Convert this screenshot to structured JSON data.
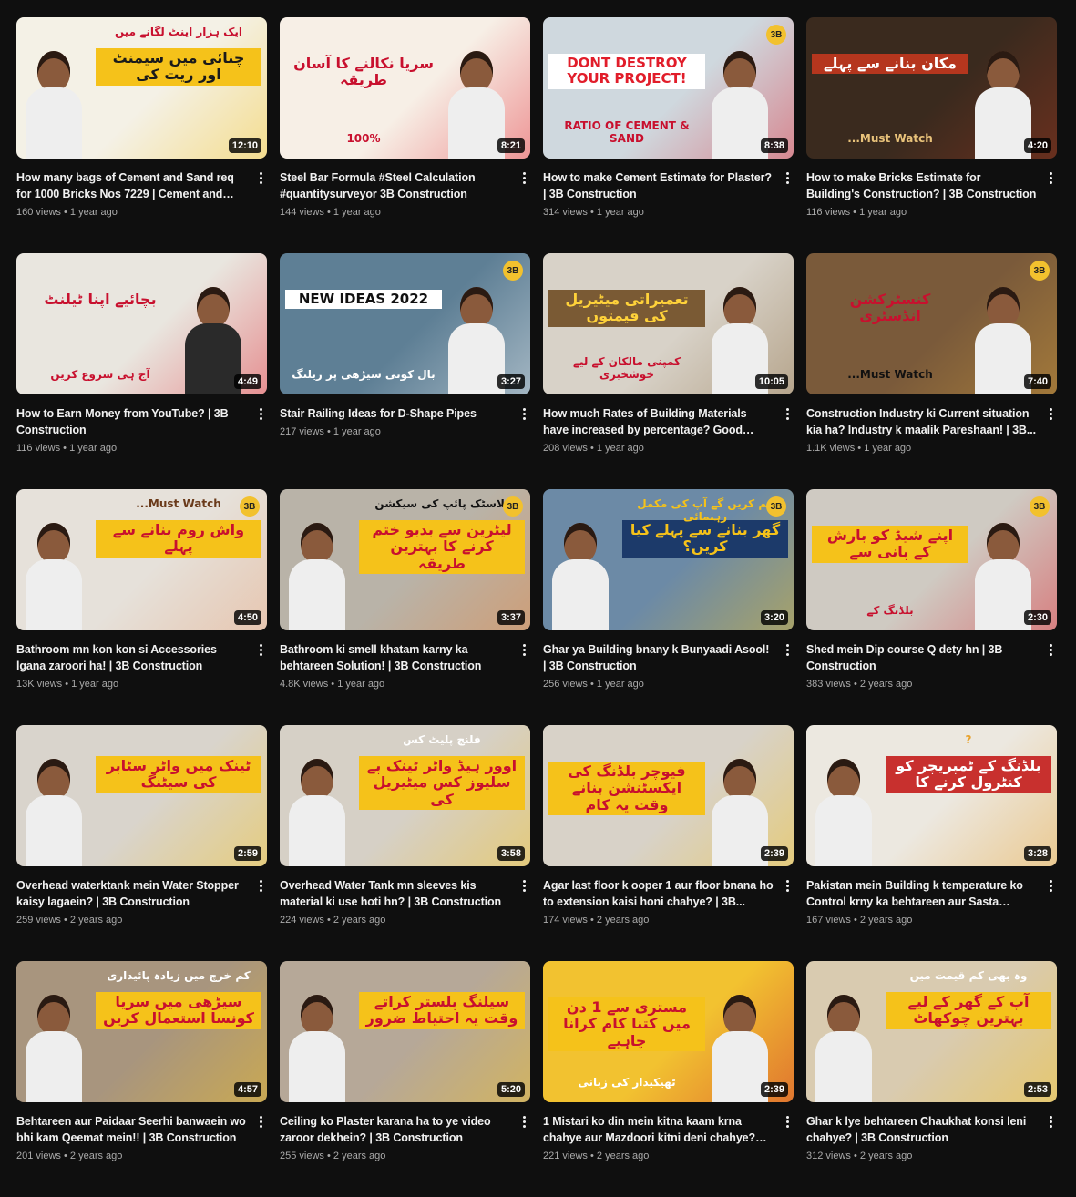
{
  "videos": [
    {
      "title": "How many bags of Cement and Sand req for 1000 Bricks Nos 7229 | Cement and Sand i...",
      "views": "160 views",
      "age": "1 year ago",
      "duration": "12:10",
      "thumb": {
        "bg": "#f4f1e6",
        "accent": "#f5c21a",
        "overlay_color": "#1a1a1a",
        "overlay_bg": "#f5c21a",
        "overlay": "چنائی میں سیمنٹ اور ریت کی",
        "overlay2": "ایک ہزار اینٹ لگانے میں",
        "overlay2_color": "#c8102e"
      }
    },
    {
      "title": "Steel Bar Formula #Steel Calculation #quantitysurveyor 3B Construction",
      "views": "144 views",
      "age": "1 year ago",
      "duration": "8:21",
      "thumb": {
        "bg": "#f7efe6",
        "accent": "#e11d2a",
        "overlay_color": "#c8102e",
        "overlay_bg": "transparent",
        "overlay": "سریا نکالنے کا آسان طریقہ",
        "overlay2": "100%",
        "overlay2_color": "#c8102e"
      }
    },
    {
      "title": "How to make Cement Estimate for Plaster? | 3B Construction",
      "views": "314 views",
      "age": "1 year ago",
      "duration": "8:38",
      "thumb": {
        "bg": "#cfd8de",
        "accent": "#e11d2a",
        "overlay_color": "#e11d2a",
        "overlay_bg": "#ffffff",
        "overlay": "DONT DESTROY YOUR PROJECT!",
        "overlay2": "RATIO OF CEMENT & SAND",
        "overlay2_color": "#c8102e",
        "en": true,
        "badge": "3B"
      }
    },
    {
      "title": "How to make Bricks Estimate for Building's Construction? | 3B Construction",
      "views": "116 views",
      "age": "1 year ago",
      "duration": "4:20",
      "thumb": {
        "bg": "#3a2a1e",
        "accent": "#a8371e",
        "overlay_color": "#ffffff",
        "overlay_bg": "#b5361e",
        "overlay": "مکان بنانے سے پہلے",
        "overlay2": "Must Watch...",
        "overlay2_color": "#e8c27a"
      }
    },
    {
      "title": "How to Earn Money from YouTube? | 3B Construction",
      "views": "116 views",
      "age": "1 year ago",
      "duration": "4:49",
      "thumb": {
        "bg": "#e9e6df",
        "accent": "#e11d2a",
        "overlay_color": "#c8102e",
        "overlay_bg": "transparent",
        "overlay": "بچائیے اپنا ٹیلنٹ",
        "overlay2": "آج ہی شروع کریں",
        "overlay2_color": "#c8102e",
        "dark": true
      }
    },
    {
      "title": "Stair Railing Ideas for D-Shape Pipes",
      "views": "217 views",
      "age": "1 year ago",
      "duration": "3:27",
      "thumb": {
        "bg": "#5e7f95",
        "accent": "#ffffff",
        "overlay_color": "#111111",
        "overlay_bg": "#ffffff",
        "overlay": "NEW IDEAS 2022",
        "overlay2": "بال کونی سیڑھی پر ریلنگ",
        "overlay2_color": "#ffffff",
        "en": true,
        "badge": "3B"
      }
    },
    {
      "title": "How much Rates of Building Materials have increased by percentage? Good news for...",
      "views": "208 views",
      "age": "1 year ago",
      "duration": "10:05",
      "thumb": {
        "bg": "#d8d2c8",
        "accent": "#8a6a3e",
        "overlay_color": "#ffd23a",
        "overlay_bg": "#7a5a34",
        "overlay": "تعمیراتی میٹیریل کی قیمتوں",
        "overlay2": "کمپنی مالکان کے لیے خوشخبری",
        "overlay2_color": "#c8102e"
      }
    },
    {
      "title": "Construction Industry ki Current situation kia ha? Industry k maalik Pareshaan! | 3B...",
      "views": "1.1K views",
      "age": "1 year ago",
      "duration": "7:40",
      "thumb": {
        "bg": "#7a5a3a",
        "accent": "#d8a23a",
        "overlay_color": "#c8102e",
        "overlay_bg": "transparent",
        "overlay": "کنسٹرکشن انڈسٹری",
        "overlay2": "Must Watch...",
        "overlay2_color": "#111111",
        "badge": "3B"
      }
    },
    {
      "title": "Bathroom mn kon kon si Accessories lgana zaroori ha! | 3B Construction",
      "views": "13K views",
      "age": "1 year ago",
      "duration": "4:50",
      "thumb": {
        "bg": "#e6e1da",
        "accent": "#e8a37a",
        "overlay_color": "#c8102e",
        "overlay_bg": "#f5c21a",
        "overlay": "واش روم بنانے سے پہلے",
        "overlay2": "Must Watch...",
        "overlay2_color": "#6a3a1a",
        "badge": "3B"
      }
    },
    {
      "title": "Bathroom ki smell khatam karny ka behtareen Solution! | 3B Construction",
      "views": "4.8K views",
      "age": "1 year ago",
      "duration": "3:37",
      "thumb": {
        "bg": "#b9b3a8",
        "accent": "#e8833a",
        "overlay_color": "#c8102e",
        "overlay_bg": "#f5c21a",
        "overlay": "لیٹرین سے بدبو ختم کرنے کا بہترین طریقہ",
        "overlay2": "پلاسٹک پائپ کی سیکشن",
        "overlay2_color": "#111111",
        "badge": "3B"
      }
    },
    {
      "title": "Ghar ya Building bnany k Bunyaadi Asool! | 3B Construction",
      "views": "256 views",
      "age": "1 year ago",
      "duration": "3:20",
      "thumb": {
        "bg": "#6c8aa6",
        "accent": "#f5c21a",
        "overlay_color": "#f5c21a",
        "overlay_bg": "#1c3a6a",
        "overlay": "گھر بنانے سے پہلے کیا کریں؟",
        "overlay2": "ہم کریں گے آپ کی مکمل رہنمائی",
        "overlay2_color": "#f5c21a",
        "badge": "3B"
      }
    },
    {
      "title": "Shed mein Dip course Q dety hn | 3B Construction",
      "views": "383 views",
      "age": "2 years ago",
      "duration": "2:30",
      "thumb": {
        "bg": "#cfcac2",
        "accent": "#e11d2a",
        "overlay_color": "#c8102e",
        "overlay_bg": "#f5c21a",
        "overlay": "اپنے شیڈ کو بارش کے پانی سے",
        "overlay2": "بلڈنگ کے",
        "overlay2_color": "#c8102e",
        "badge": "3B"
      }
    },
    {
      "title": "Overhead waterktank mein Water Stopper kaisy lagaein? | 3B Construction",
      "views": "259 views",
      "age": "2 years ago",
      "duration": "2:59",
      "thumb": {
        "bg": "#d9d4cc",
        "accent": "#f5c21a",
        "overlay_color": "#c8102e",
        "overlay_bg": "#f5c21a",
        "overlay": "ٹینک میں واٹر سٹاپر کی سیٹنگ",
        "overlay2": "",
        "overlay2_color": "#c8102e"
      }
    },
    {
      "title": "Overhead Water Tank mn sleeves kis material ki use hoti hn? | 3B Construction",
      "views": "224 views",
      "age": "2 years ago",
      "duration": "3:58",
      "thumb": {
        "bg": "#d6d0c6",
        "accent": "#f5c21a",
        "overlay_color": "#c8102e",
        "overlay_bg": "#f5c21a",
        "overlay": "اوور ہیڈ واٹر ٹینک پے سلیوز کس میٹیریل کی",
        "overlay2": "فلنچ پلیٹ کس",
        "overlay2_color": "#ffffff"
      }
    },
    {
      "title": "Agar last floor k ooper 1 aur floor bnana ho to extension kaisi honi chahye? | 3B...",
      "views": "174 views",
      "age": "2 years ago",
      "duration": "2:39",
      "thumb": {
        "bg": "#d8d2c8",
        "accent": "#f5c21a",
        "overlay_color": "#c8102e",
        "overlay_bg": "#f5c21a",
        "overlay": "فیوچر بلڈنگ کی ایکسٹنشن بنانے وقت یہ کام",
        "overlay2": "",
        "overlay2_color": "#c8102e"
      }
    },
    {
      "title": "Pakistan mein Building k temperature ko Control krny ka behtareen aur Sasta Tariqa|...",
      "views": "167 views",
      "age": "2 years ago",
      "duration": "3:28",
      "thumb": {
        "bg": "#ece8e0",
        "accent": "#e8a12a",
        "overlay_color": "#ffffff",
        "overlay_bg": "#c8302e",
        "overlay": "بلڈنگ کے ٹمپریچر کو کنٹرول کرنے کا",
        "overlay2": "?",
        "overlay2_color": "#e8a12a"
      }
    },
    {
      "title": "Behtareen aur Paidaar Seerhi banwaein wo bhi kam Qeemat mein!! | 3B Construction",
      "views": "201 views",
      "age": "2 years ago",
      "duration": "4:57",
      "thumb": {
        "bg": "#a8957e",
        "accent": "#f5c21a",
        "overlay_color": "#c8102e",
        "overlay_bg": "#f5c21a",
        "overlay": "سیڑھی میں سریا کونسا استعمال کریں",
        "overlay2": "کم خرچ میں زیادہ پائیداری",
        "overlay2_color": "#ffffff"
      }
    },
    {
      "title": "Ceiling ko Plaster karana ha to ye video zaroor dekhein? | 3B Construction",
      "views": "255 views",
      "age": "2 years ago",
      "duration": "5:20",
      "thumb": {
        "bg": "#b6a898",
        "accent": "#f5c21a",
        "overlay_color": "#c8102e",
        "overlay_bg": "#f5c21a",
        "overlay": "سیلنگ پلستر کراتے وقت یہ احتیاط ضرور",
        "overlay2": "",
        "overlay2_color": "#c8102e"
      }
    },
    {
      "title": "1 Mistari ko din mein kitna kaam krna chahye aur Mazdoori kitni deni chahye?? | ...",
      "views": "221 views",
      "age": "2 years ago",
      "duration": "2:39",
      "thumb": {
        "bg": "#f2c230",
        "accent": "#c8102e",
        "overlay_color": "#c8102e",
        "overlay_bg": "#f5c21a",
        "overlay": "مستری سے 1 دن میں کتنا کام کرانا چاہیے",
        "overlay2": "ٹھیکیدار کی زبانی",
        "overlay2_color": "#ffffff"
      }
    },
    {
      "title": "Ghar k lye behtareen Chaukhat konsi leni chahye? | 3B Construction",
      "views": "312 views",
      "age": "2 years ago",
      "duration": "2:53",
      "thumb": {
        "bg": "#d9cbb0",
        "accent": "#f5c21a",
        "overlay_color": "#c8102e",
        "overlay_bg": "#f5c21a",
        "overlay": "آپ کے گھر کے لیے بہترین چوکھاٹ",
        "overlay2": "وہ بھی کم قیمت میں",
        "overlay2_color": "#ffffff"
      }
    }
  ]
}
